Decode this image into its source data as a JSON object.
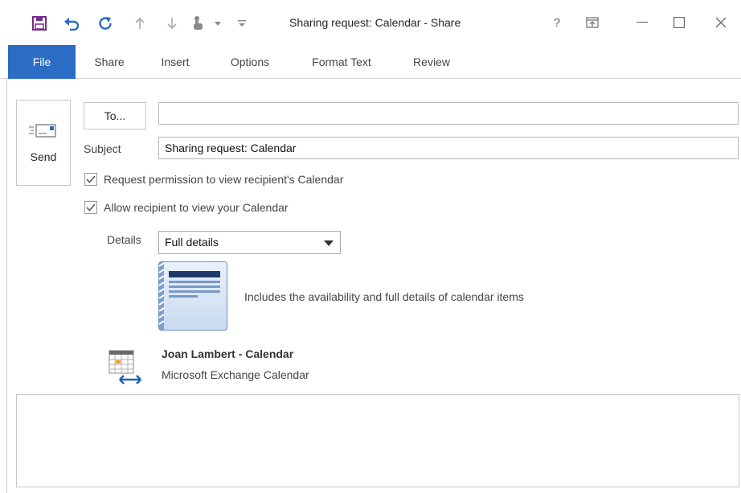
{
  "window": {
    "title": "Sharing request: Calendar  -  Share",
    "help": "?",
    "icons": [
      "save-icon",
      "undo-icon",
      "redo-icon",
      "up-arrow-icon",
      "down-arrow-icon",
      "touch-mode-icon",
      "dropdown-icon",
      "customize-icon",
      "ribbon-display-icon",
      "minimize-icon",
      "maximize-icon",
      "close-icon"
    ]
  },
  "ribbon": {
    "tabs": [
      {
        "label": "File"
      },
      {
        "label": "Share"
      },
      {
        "label": "Insert"
      },
      {
        "label": "Options"
      },
      {
        "label": "Format Text"
      },
      {
        "label": "Review"
      }
    ]
  },
  "compose": {
    "send_label": "Send",
    "to_label": "To...",
    "to_value": "",
    "subject_label": "Subject",
    "subject_value": "Sharing request: Calendar",
    "request_permission_label": "Request permission to view recipient's Calendar",
    "request_permission_checked": true,
    "allow_view_label": "Allow recipient to view your Calendar",
    "allow_view_checked": true,
    "details_label": "Details",
    "details_value": "Full details",
    "details_description": "Includes the availability and full details of calendar items",
    "calendar_name": "Joan Lambert - Calendar",
    "calendar_type": "Microsoft Exchange Calendar"
  },
  "colors": {
    "accent": "#2b6cc4",
    "save_icon": "#7a2a8c",
    "undo_icon": "#2b6cc4",
    "preview_blue": "#1e3a6a"
  }
}
